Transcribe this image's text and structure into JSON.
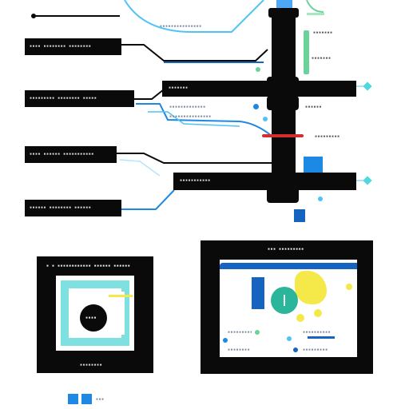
{
  "colors": {
    "ink": "#0a0a0a",
    "blue_line": "#1e88e5",
    "teal_line": "#4fc3f7",
    "accent_red": "#d32f2f",
    "green_bar": "#69d39a",
    "yellow_blob": "#f5e94a",
    "teal_panel": "#7ee0e0",
    "legend_blue": "#1565c0"
  },
  "top_left_marker": "",
  "left_boxes": [
    {
      "label": "▪▪▪▪ ▪▪▪▪▪▪▪▪ ▪▪▪▪▪▪▪▪"
    },
    {
      "label": "▪▪▪▪▪▪▪▪▪ ▪▪▪▪▪▪▪▪ ▪▪▪▪▪"
    },
    {
      "label": "▪▪▪▪ ▪▪▪▪▪▪ ▪▪▪▪▪▪▪▪▪▪▪"
    },
    {
      "label": "▪▪▪▪▪▪ ▪▪▪▪▪▪▪▪ ▪▪▪▪▪▪"
    }
  ],
  "mid_boxes": [
    {
      "label": "▪▪▪▪▪▪▪"
    },
    {
      "label": "▪▪▪▪▪▪▪▪▪▪▪"
    }
  ],
  "side_labels": [
    {
      "label": "▪▪▪▪▪▪▪"
    },
    {
      "label": "▪▪▪▪▪▪▪"
    },
    {
      "label": "▪▪▪▪▪▪"
    },
    {
      "label": "▪▪▪▪▪▪▪▪▪"
    }
  ],
  "faint_labels": [
    {
      "label": "▪▪▪▪▪▪▪▪▪▪▪▪▪▪▪"
    },
    {
      "label": "▪▪▪▪▪▪▪▪▪▪▪▪▪"
    },
    {
      "label": "▪▪▪▪▪▪▪▪▪▪▪▪▪▪▪"
    }
  ],
  "panel_left": {
    "title": "▪ ▪ ▪▪▪▪▪▪▪▪▪▪▪▪ ▪▪▪▪▪▪ ▪▪▪▪▪▪",
    "center_text": "▪▪▪▪",
    "caption": "▪▪▪▪▪▪▪▪"
  },
  "panel_right": {
    "title": "▪▪▪ ▪▪▪▪▪▪▪▪▪",
    "row1": "▪▪▪▪▪▪▪▪▪▪",
    "row1b": "▪▪▪▪▪▪▪▪▪▪",
    "row2": "▪▪▪▪▪▪▪▪",
    "row2b": "▪▪▪▪▪▪▪▪▪"
  },
  "legend": {
    "label": "▪▪▪"
  }
}
